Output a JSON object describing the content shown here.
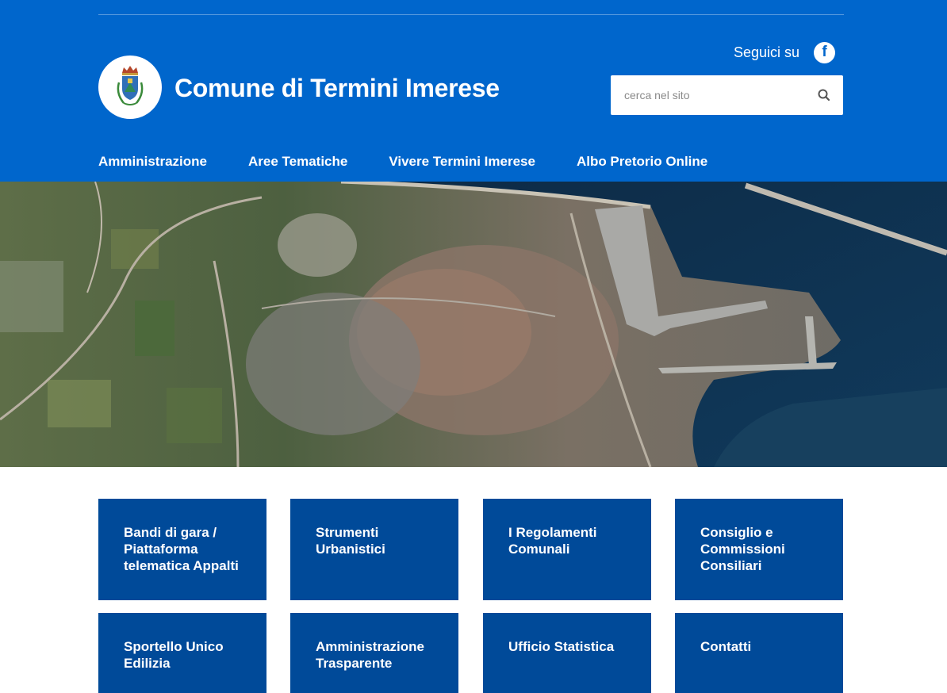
{
  "header": {
    "site_title": "Comune di Termini Imerese",
    "social_label": "Seguici su",
    "social_icon": "facebook-icon",
    "search_placeholder": "cerca nel sito",
    "search_icon": "search-icon",
    "brand_color": "#0066cc"
  },
  "nav": {
    "items": [
      {
        "label": "Amministrazione"
      },
      {
        "label": "Aree Tematiche"
      },
      {
        "label": "Vivere Termini Imerese"
      },
      {
        "label": "Albo Pretorio Online"
      }
    ]
  },
  "tiles": {
    "color": "#004a99",
    "items": [
      {
        "label": "Bandi di gara / Piattaforma telematica Appalti"
      },
      {
        "label": "Strumenti Urbanistici"
      },
      {
        "label": "I Regolamenti Comunali"
      },
      {
        "label": "Consiglio e Commissioni Consiliari"
      },
      {
        "label": "Sportello Unico Edilizia"
      },
      {
        "label": "Amministrazione Trasparente"
      },
      {
        "label": "Ufficio Statistica"
      },
      {
        "label": "Contatti"
      }
    ]
  }
}
